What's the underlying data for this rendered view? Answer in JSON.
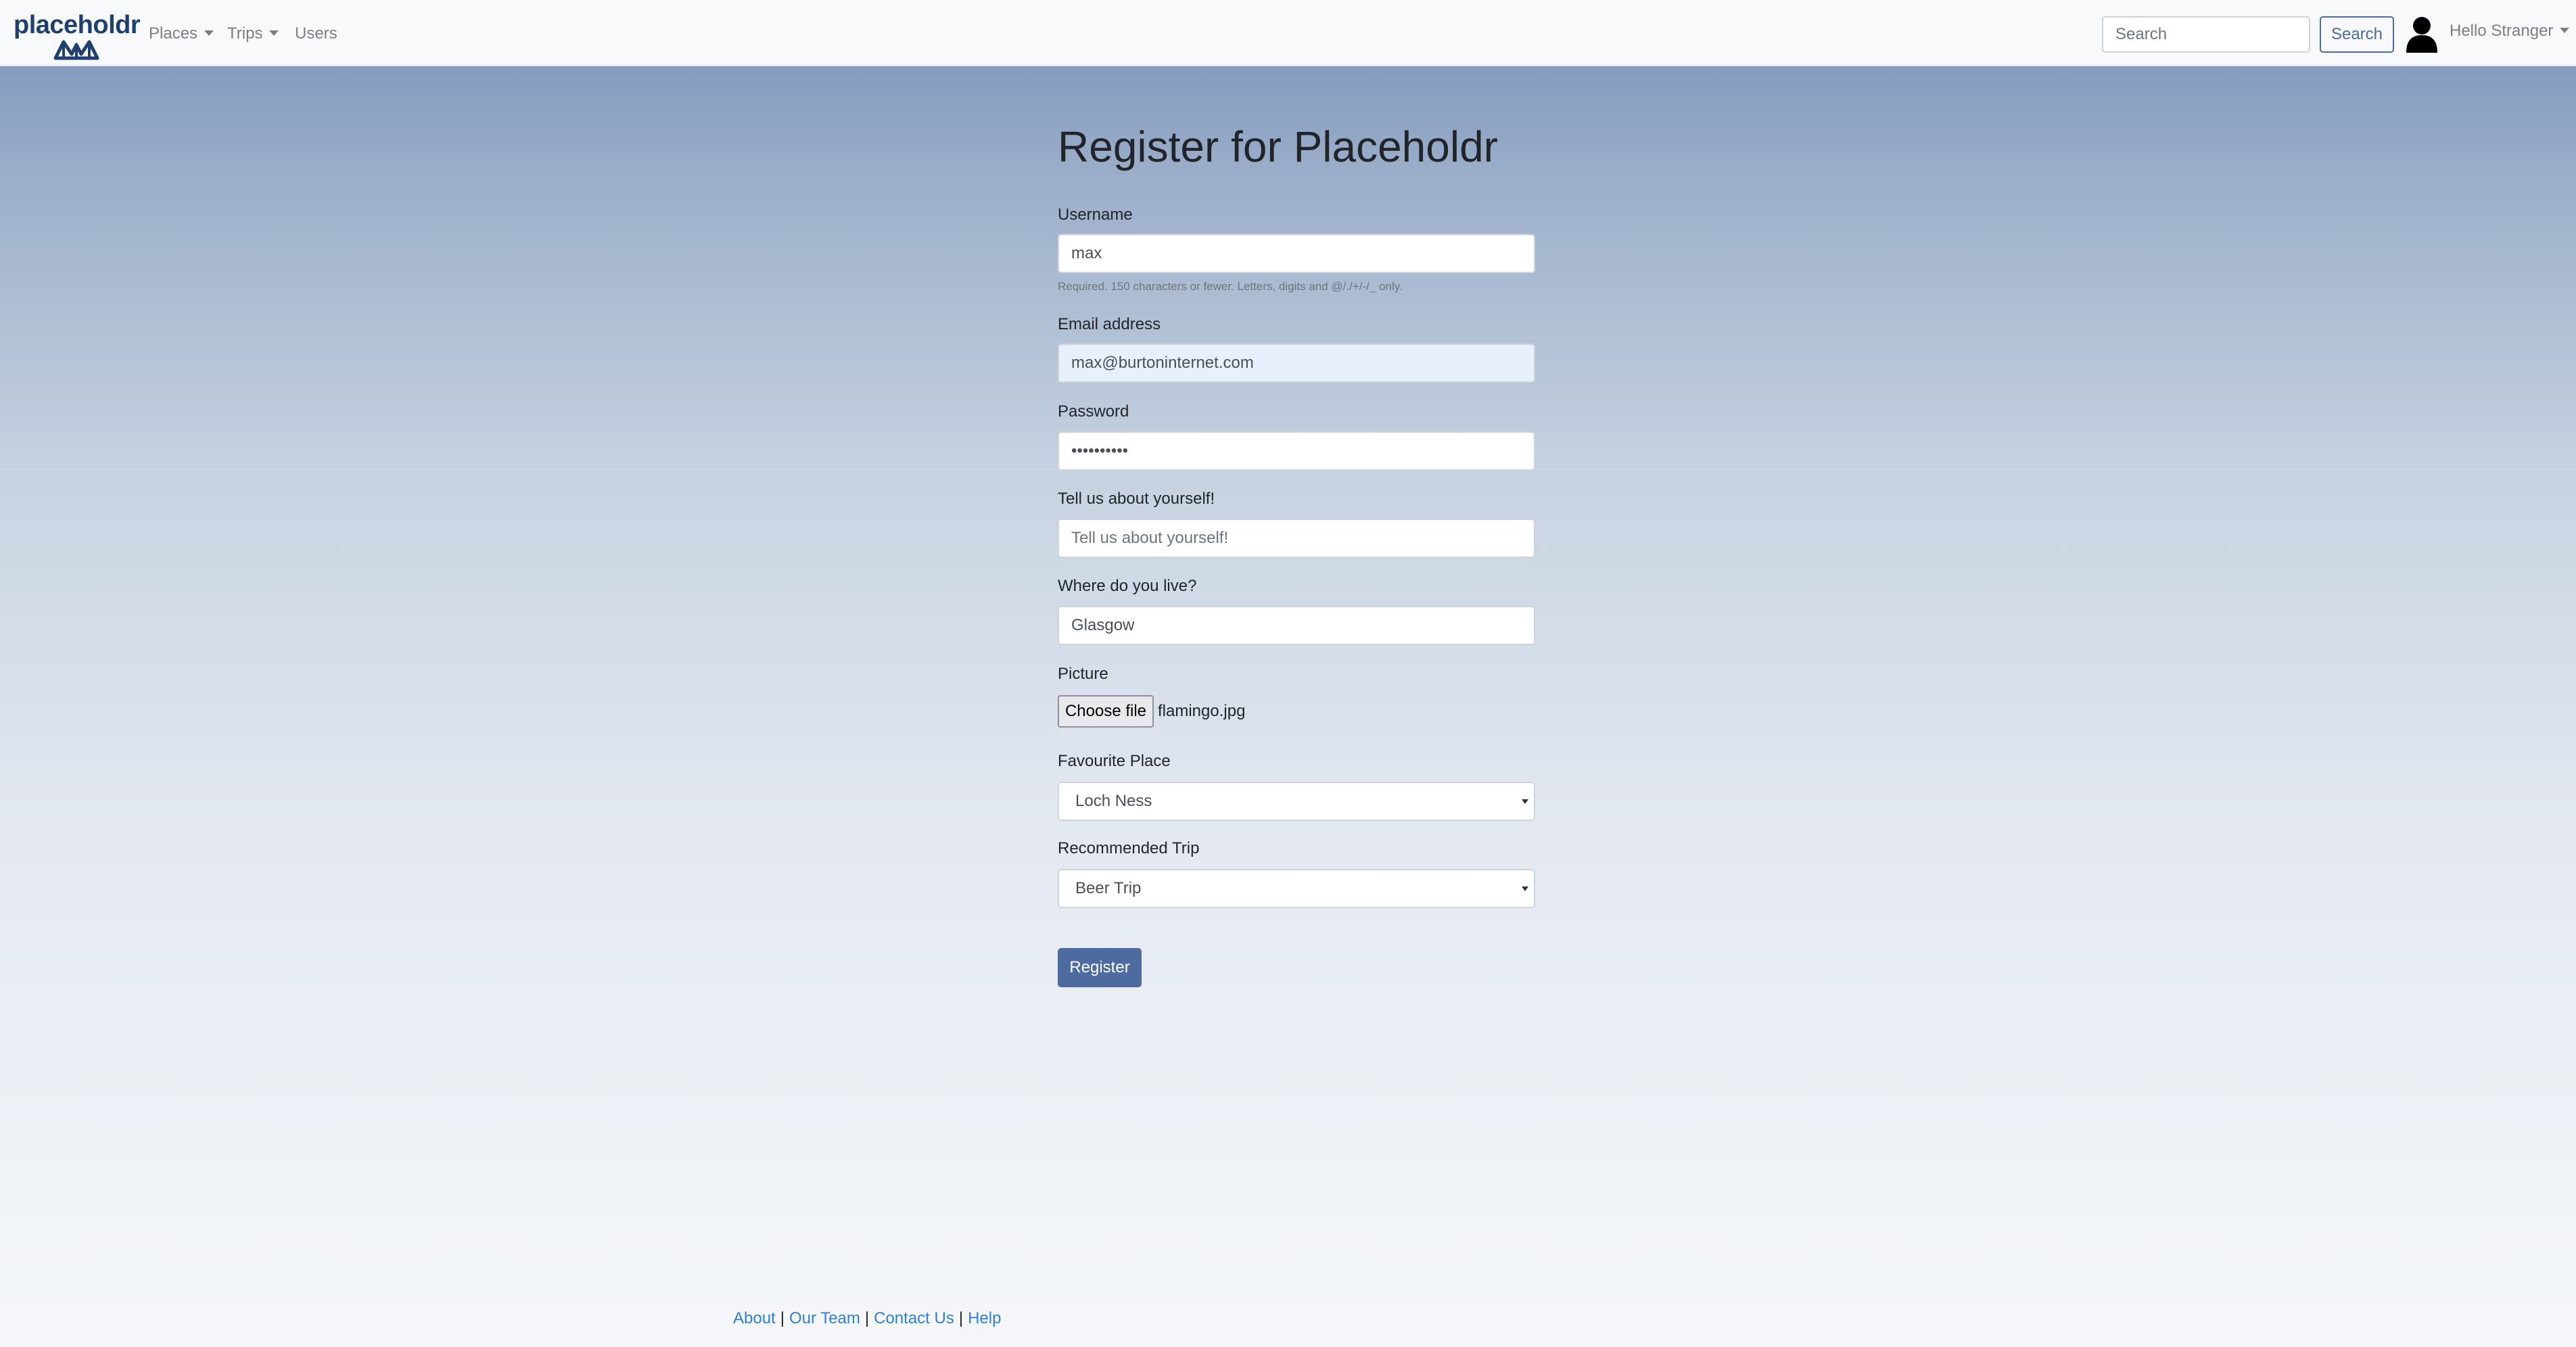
{
  "navbar": {
    "logo_text": "placeholdr",
    "items": [
      {
        "label": "Places",
        "dropdown": true
      },
      {
        "label": "Trips",
        "dropdown": true
      },
      {
        "label": "Users",
        "dropdown": false
      }
    ],
    "search_placeholder": "Search",
    "search_button": "Search",
    "user_menu": "Hello Stranger",
    "icons": [
      "logo-map-icon",
      "user-avatar-icon",
      "caret-down-icon"
    ]
  },
  "form": {
    "title": "Register for Placeholdr",
    "username": {
      "label": "Username",
      "value": "max",
      "help": "Required. 150 characters or fewer. Letters, digits and @/./+/-/_ only."
    },
    "email": {
      "label": "Email address",
      "value": "max@burtoninternet.com"
    },
    "password": {
      "label": "Password",
      "value": "••••••••••"
    },
    "about": {
      "label": "Tell us about yourself!",
      "placeholder": "Tell us about yourself!",
      "value": ""
    },
    "location": {
      "label": "Where do you live?",
      "value": "Glasgow"
    },
    "picture": {
      "label": "Picture",
      "button": "Choose file",
      "filename": "flamingo.jpg"
    },
    "favourite_place": {
      "label": "Favourite Place",
      "selected": "Loch Ness"
    },
    "recommended_trip": {
      "label": "Recommended Trip",
      "selected": "Beer Trip"
    },
    "submit": "Register"
  },
  "footer": {
    "links": [
      "About",
      "Our Team",
      "Contact Us",
      "Help"
    ],
    "separator": "|"
  },
  "colors": {
    "primary": "#4d6b9e",
    "link": "#2f7fd9",
    "navbar_bg": "#f8f9fa"
  }
}
